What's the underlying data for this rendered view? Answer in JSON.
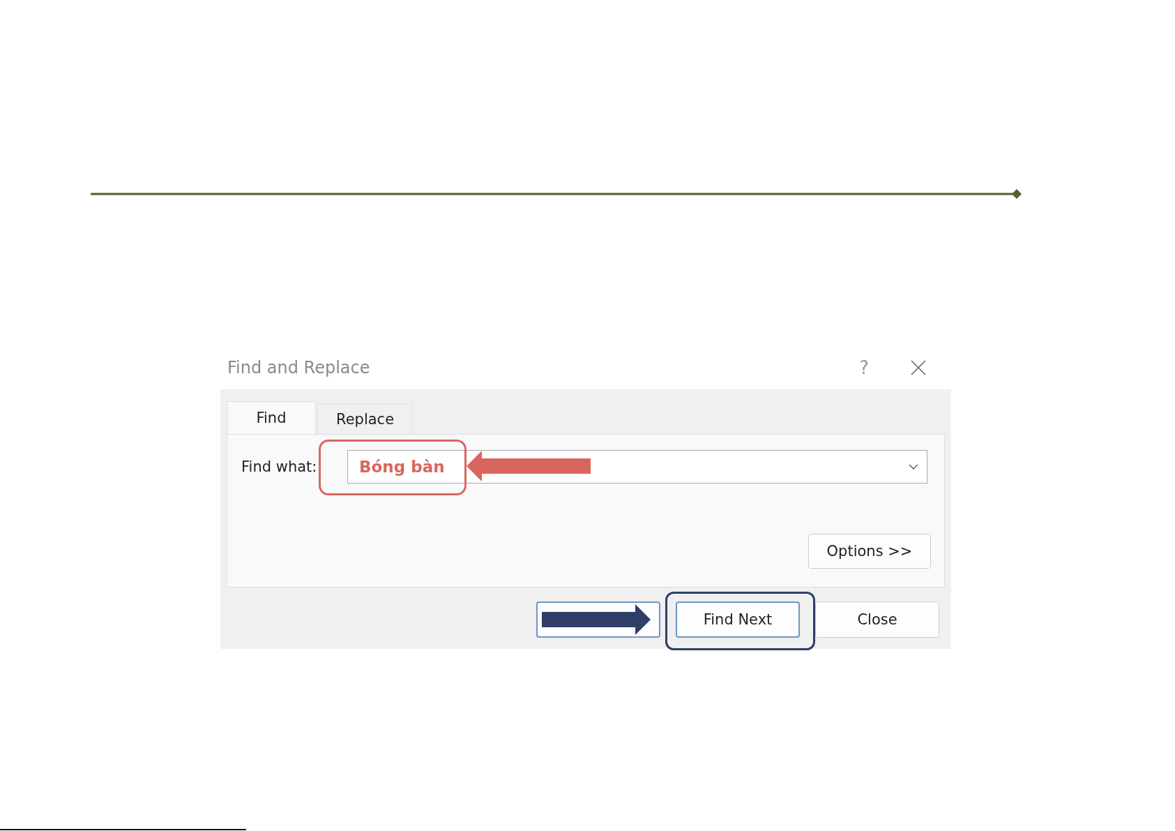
{
  "dialog": {
    "title": "Find and Replace",
    "help": "?",
    "tabs": [
      {
        "label": "Find",
        "selected": true
      },
      {
        "label": "Replace",
        "selected": false
      }
    ],
    "find_what": {
      "label": "Find what:",
      "value": "Bóng bàn"
    },
    "options_button": "Options >>",
    "buttons": [
      {
        "kind": "blank"
      },
      {
        "label": "Find Next",
        "kind": "highlighted"
      },
      {
        "label": "Close",
        "kind": "plain"
      }
    ]
  }
}
